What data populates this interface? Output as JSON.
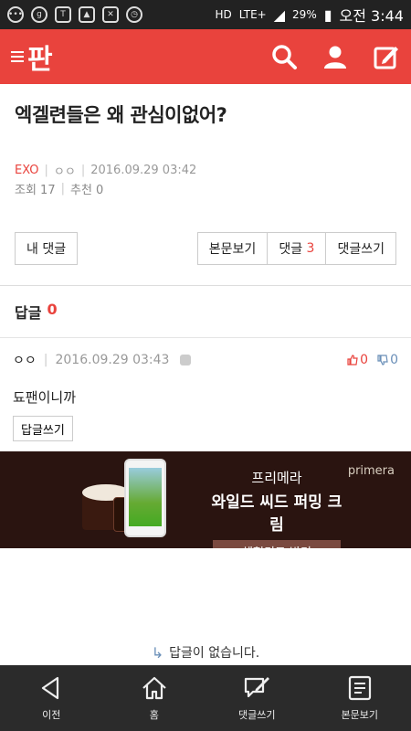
{
  "status_bar": {
    "left_icons": [
      "ellipsis-icon",
      "g-icon",
      "talk-icon",
      "image-icon",
      "mute-icon",
      "alarm-icon"
    ],
    "hd": "HD",
    "network": "LTE+",
    "battery": "29%",
    "time": "오전 3:44"
  },
  "app": {
    "logo": "판",
    "accent": "#e9433d"
  },
  "post": {
    "title": "엑겔련들은 왜 관심이없어?",
    "category": "EXO",
    "author": "ㅇㅇ",
    "datetime": "2016.09.29 03:42",
    "views_label": "조회 17",
    "recommend_label": "추천 0"
  },
  "buttons": {
    "my_comments": "내 댓글",
    "view_post": "본문보기",
    "comments_label": "댓글",
    "comments_count": "3",
    "write_comment": "댓글쓰기"
  },
  "replies": {
    "label": "답글",
    "count": "0"
  },
  "comment": {
    "author": "ㅇㅇ",
    "datetime": "2016.09.29 03:43",
    "likes": "0",
    "dislikes": "0",
    "body": "됴팬이니까",
    "reply_button": "답글쓰기"
  },
  "ad": {
    "brand": "primera",
    "line1": "프리메라",
    "line2": "와일드 씨드 퍼밍 크림",
    "cta": "체험키트 받기"
  },
  "empty_state": "답글이 없습니다.",
  "bottom_nav": {
    "back": "이전",
    "home": "홈",
    "write": "댓글쓰기",
    "view": "본문보기"
  }
}
